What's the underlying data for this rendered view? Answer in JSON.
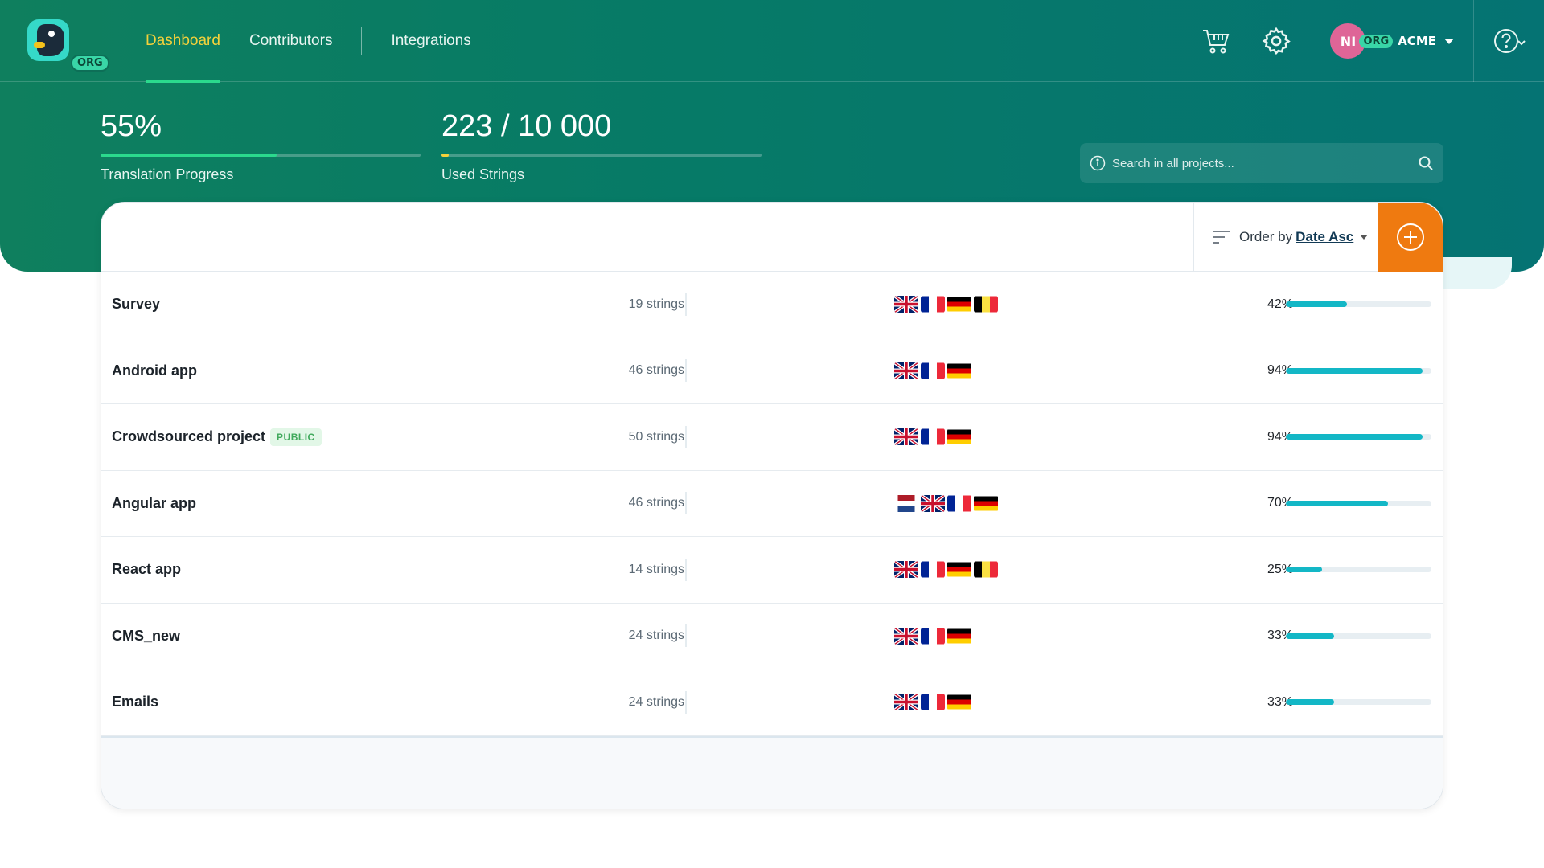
{
  "nav": {
    "logo_badge": "ORG",
    "items": [
      {
        "label": "Dashboard",
        "active": true
      },
      {
        "label": "Contributors",
        "active": false
      },
      {
        "label": "Integrations",
        "active": false
      }
    ]
  },
  "user": {
    "initials": "NI",
    "org_badge": "ORG",
    "org_name": "ACME"
  },
  "stats": {
    "progress": {
      "value": "55%",
      "label": "Translation Progress",
      "fraction": 0.55,
      "color": "#2bd98d"
    },
    "strings": {
      "value": "223 / 10 000",
      "label": "Used Strings",
      "fraction": 0.0223,
      "color": "#f4d13a"
    }
  },
  "search": {
    "placeholder": "Search in all projects..."
  },
  "order": {
    "prefix": "Order by",
    "value": "Date Asc"
  },
  "projects": [
    {
      "name": "Survey",
      "public": false,
      "strings": "19 strings",
      "flags": [
        "gb",
        "fr",
        "de",
        "be"
      ],
      "percent": "42%",
      "fraction": 0.42
    },
    {
      "name": "Android app",
      "public": false,
      "strings": "46 strings",
      "flags": [
        "gb",
        "fr",
        "de"
      ],
      "percent": "94%",
      "fraction": 0.94
    },
    {
      "name": "Crowdsourced project",
      "public": true,
      "strings": "50 strings",
      "flags": [
        "gb",
        "fr",
        "de"
      ],
      "percent": "94%",
      "fraction": 0.94
    },
    {
      "name": "Angular app",
      "public": false,
      "strings": "46 strings",
      "flags": [
        "nl",
        "gb",
        "fr",
        "de"
      ],
      "percent": "70%",
      "fraction": 0.7
    },
    {
      "name": "React app",
      "public": false,
      "strings": "14 strings",
      "flags": [
        "gb",
        "fr",
        "de",
        "be"
      ],
      "percent": "25%",
      "fraction": 0.25
    },
    {
      "name": "CMS_new",
      "public": false,
      "strings": "24 strings",
      "flags": [
        "gb",
        "fr",
        "de"
      ],
      "percent": "33%",
      "fraction": 0.33
    },
    {
      "name": "Emails",
      "public": false,
      "strings": "24 strings",
      "flags": [
        "gb",
        "fr",
        "de"
      ],
      "percent": "33%",
      "fraction": 0.33
    }
  ],
  "public_tag": "PUBLIC",
  "colors": {
    "accent": "#ef7a10",
    "progress_bar": "#13b7c6",
    "brand_green": "#0f7f5e"
  }
}
